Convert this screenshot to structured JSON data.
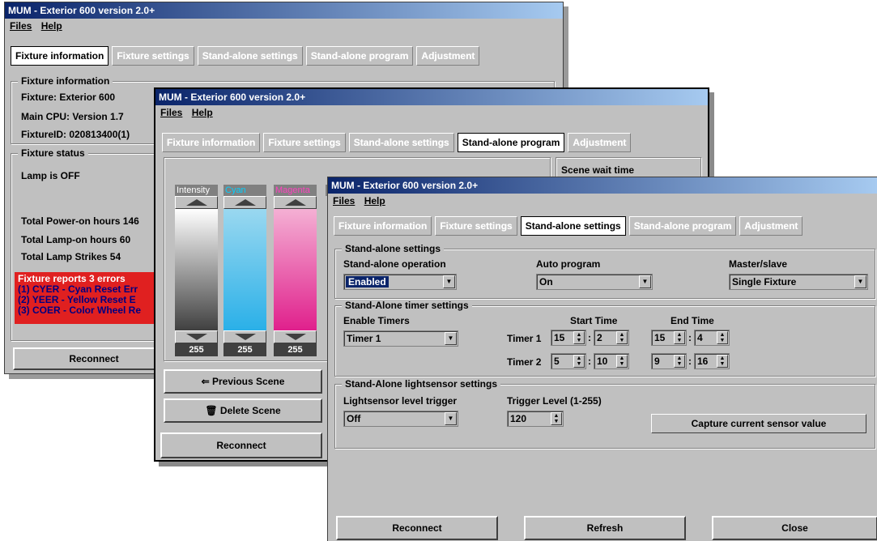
{
  "win1": {
    "title": "MUM - Exterior 600 version 2.0+",
    "menu": {
      "files": "Files",
      "help": "Help"
    },
    "tabs": [
      "Fixture information",
      "Fixture settings",
      "Stand-alone settings",
      "Stand-alone program",
      "Adjustment"
    ],
    "info_group": "Fixture information",
    "fixture": "Fixture: Exterior 600",
    "cpu": "Main CPU: Version 1.7",
    "fixture_id": "FixtureID: 020813400(1)",
    "status_group": "Fixture status",
    "lamp": "Lamp is OFF",
    "power_hours": "Total Power-on hours 146",
    "lamp_hours": "Total Lamp-on hours 60",
    "lamp_strikes": "Total Lamp Strikes 54",
    "errors": [
      "Fixture reports 3 errors",
      "(1) CYER - Cyan Reset Err",
      "(2) YEER - Yellow Reset E",
      "(3) COER - Color Wheel Re"
    ],
    "reconnect": "Reconnect"
  },
  "win2": {
    "title": "MUM - Exterior 600 version 2.0+",
    "menu": {
      "files": "Files",
      "help": "Help"
    },
    "tabs": [
      "Fixture information",
      "Fixture settings",
      "Stand-alone settings",
      "Stand-alone program",
      "Adjustment"
    ],
    "scene_wait": "Scene wait time",
    "faders": [
      {
        "name": "Intensity",
        "value": "255",
        "name_color": "#ffffff",
        "top": "#ffffff",
        "bottom": "#404040"
      },
      {
        "name": "Cyan",
        "value": "255",
        "name_color": "#00d0ff",
        "top": "#9ad8f0",
        "bottom": "#2ab0e8"
      },
      {
        "name": "Magenta",
        "value": "255",
        "name_color": "#ff40c0",
        "top": "#f4b0d4",
        "bottom": "#e0208c"
      }
    ],
    "prev_scene": "Previous Scene",
    "delete_scene": "Delete Scene",
    "reconnect": "Reconnect"
  },
  "win3": {
    "title": "MUM - Exterior 600 version 2.0+",
    "menu": {
      "files": "Files",
      "help": "Help"
    },
    "tabs": [
      "Fixture information",
      "Fixture settings",
      "Stand-alone settings",
      "Stand-alone program",
      "Adjustment"
    ],
    "sa_group": "Stand-alone settings",
    "sa_operation_label": "Stand-alone operation",
    "sa_operation_value": "Enabled",
    "auto_program_label": "Auto program",
    "auto_program_value": "On",
    "master_slave_label": "Master/slave",
    "master_slave_value": "Single Fixture",
    "timer_group": "Stand-Alone timer settings",
    "enable_timers_label": "Enable Timers",
    "enable_timers_value": "Timer 1",
    "start_time": "Start Time",
    "end_time": "End Time",
    "timer1": {
      "label": "Timer 1",
      "start_h": "15",
      "start_m": "2",
      "end_h": "15",
      "end_m": "4"
    },
    "timer2": {
      "label": "Timer 2",
      "start_h": "5",
      "start_m": "10",
      "end_h": "9",
      "end_m": "16"
    },
    "light_group": "Stand-Alone lightsensor settings",
    "ls_trigger_label": "Lightsensor level trigger",
    "ls_trigger_value": "Off",
    "trigger_level_label": "Trigger Level (1-255)",
    "trigger_level_value": "120",
    "capture_button": "Capture current sensor value",
    "reconnect": "Reconnect",
    "refresh": "Refresh",
    "close": "Close"
  }
}
